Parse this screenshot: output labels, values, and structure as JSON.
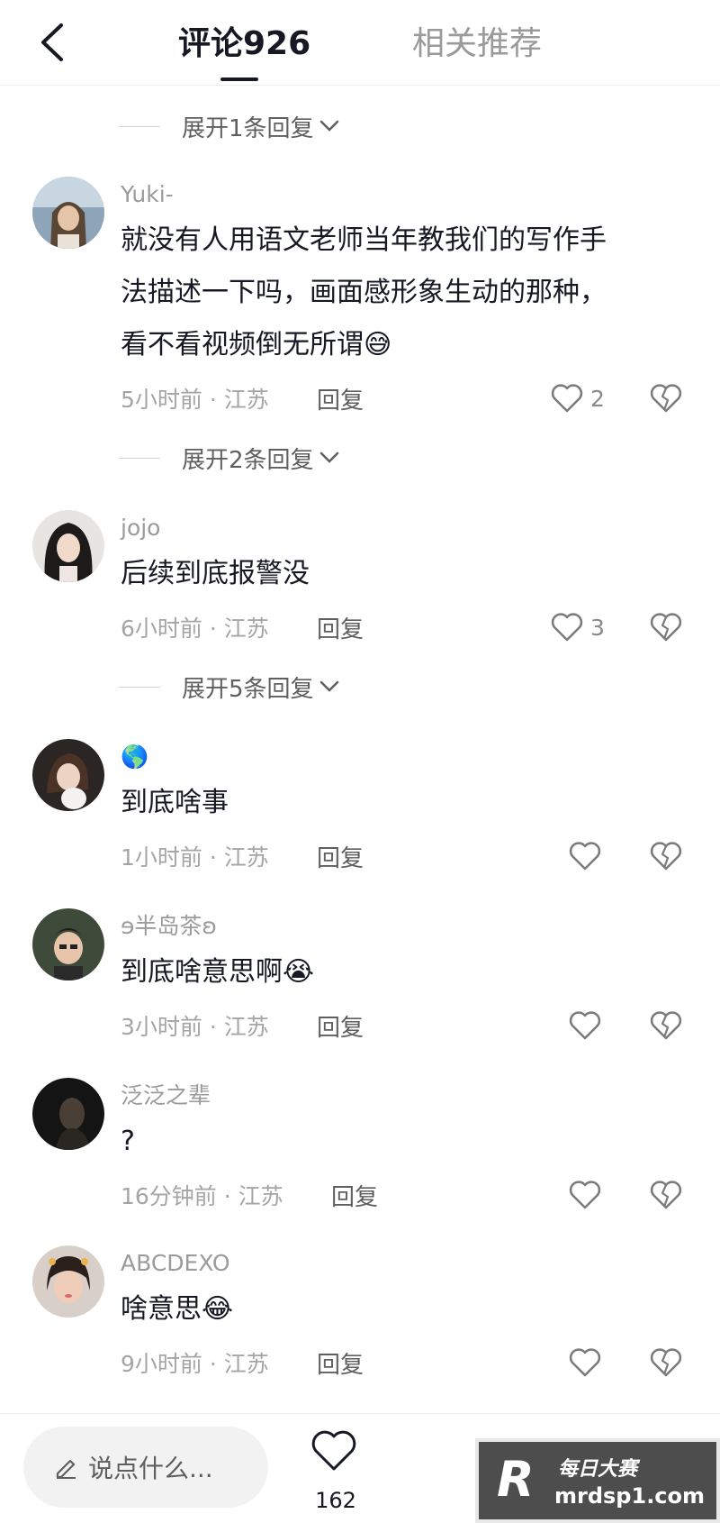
{
  "header": {
    "tab_comments": "评论926",
    "tab_related": "相关推荐"
  },
  "expand_rows": [
    "展开1条回复",
    "展开2条回复",
    "展开5条回复"
  ],
  "comments": [
    {
      "username": "Yuki-",
      "lines": [
        "就没有人用语文老师当年教我们的写作手",
        "法描述一下吗，画面感形象生动的那种，",
        "看不看视频倒无所谓😅"
      ],
      "time_location": "5小时前 · 江苏",
      "reply_label": "回复",
      "likes": "2"
    },
    {
      "username": "jojo",
      "lines": [
        "后续到底报警没"
      ],
      "time_location": "6小时前 · 江苏",
      "reply_label": "回复",
      "likes": "3"
    },
    {
      "username": "🌎",
      "lines": [
        "到底啥事"
      ],
      "time_location": "1小时前 · 江苏",
      "reply_label": "回复",
      "likes": ""
    },
    {
      "username": "ɘ半岛茶ʚ",
      "lines": [
        "到底啥意思啊😭"
      ],
      "time_location": "3小时前 · 江苏",
      "reply_label": "回复",
      "likes": ""
    },
    {
      "username": "泛泛之辈",
      "lines": [
        "?"
      ],
      "time_location": "16分钟前 · 江苏",
      "reply_label": "回复",
      "likes": ""
    },
    {
      "username": "ABCDEXO",
      "lines": [
        "啥意思😂"
      ],
      "time_location": "9小时前 · 江苏",
      "reply_label": "回复",
      "likes": ""
    }
  ],
  "bottom_bar": {
    "input_placeholder": "说点什么...",
    "like_count": "162"
  },
  "watermark": {
    "logo_letter": "R",
    "title": "每日大赛",
    "url": "mrdsp1.com"
  }
}
